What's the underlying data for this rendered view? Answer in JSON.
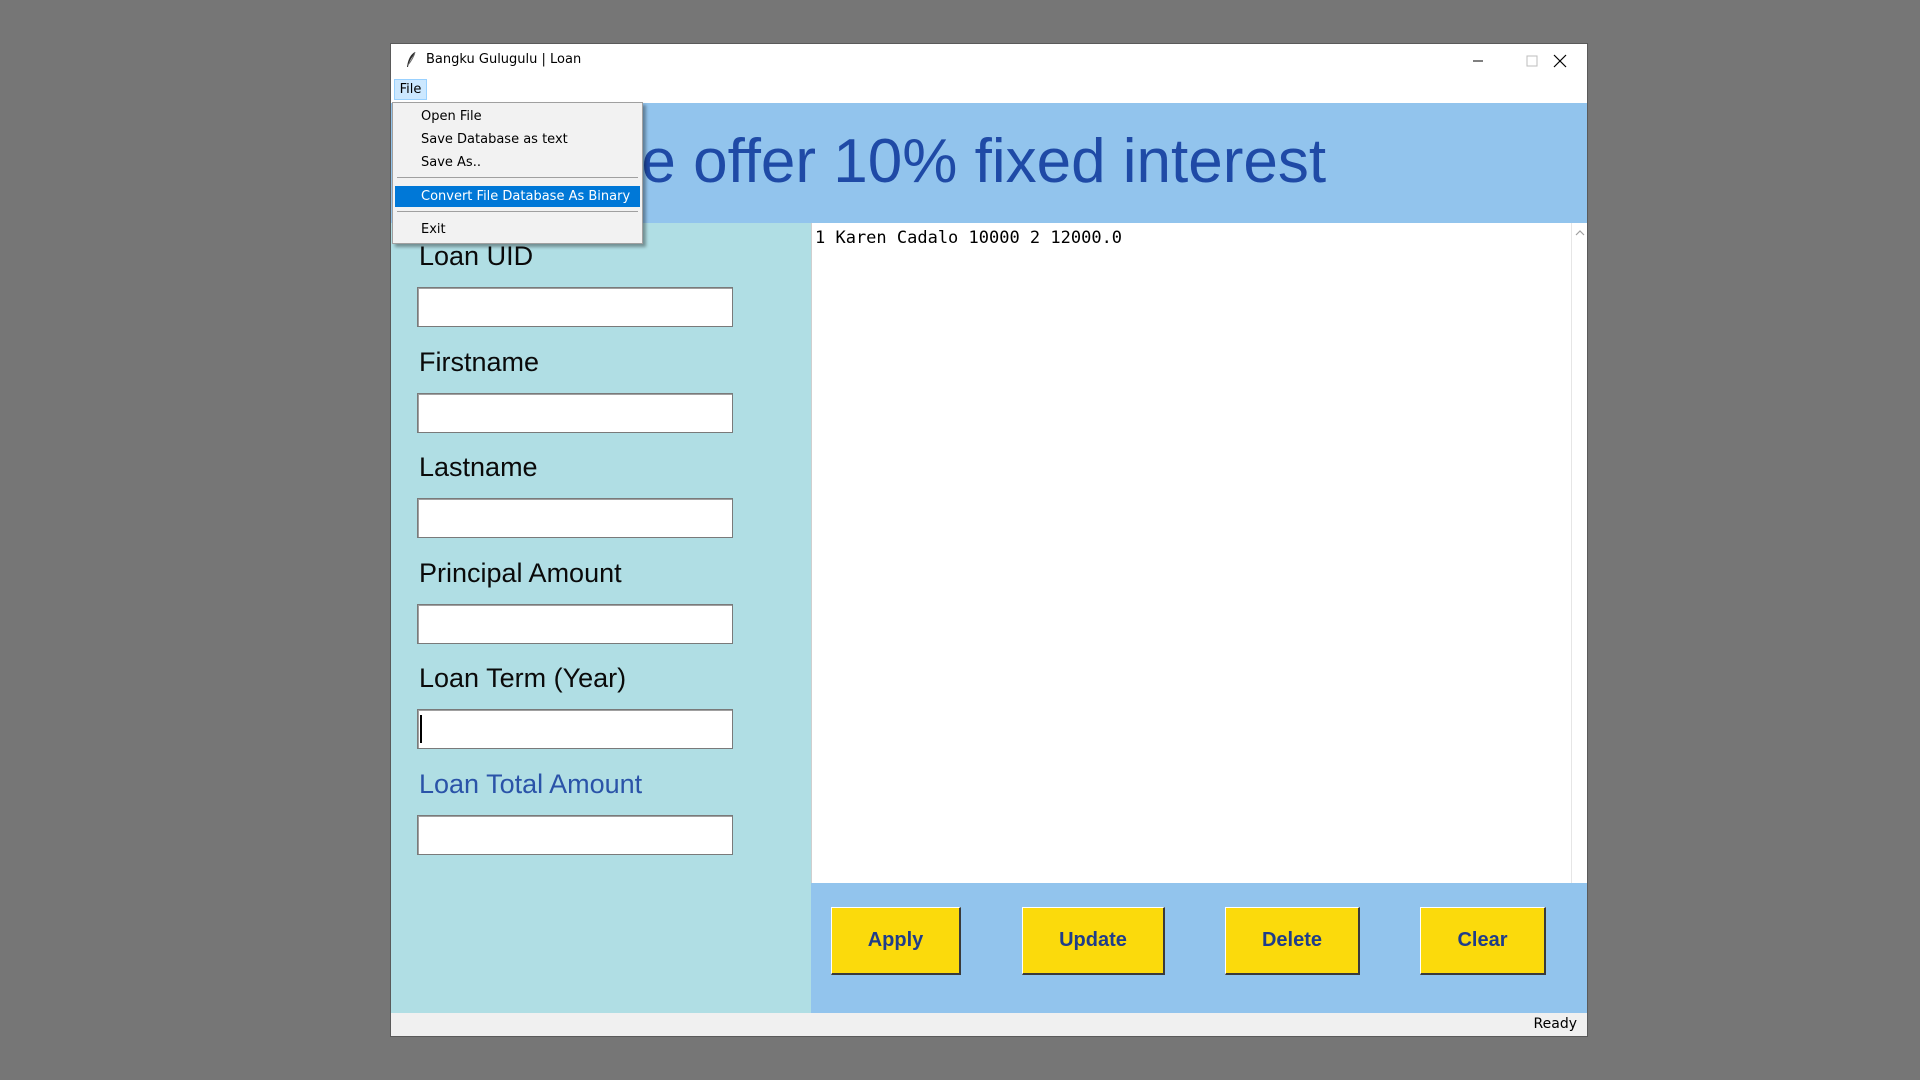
{
  "window": {
    "title": "Bangku Gulugulu | Loan",
    "app_icon": "feather-icon",
    "controls": [
      "minimize-icon",
      "maximize-icon",
      "close-icon"
    ]
  },
  "menubar": {
    "file_label": "File"
  },
  "file_menu": {
    "items": [
      "Open File",
      "Save Database as text",
      "Save As..",
      "Convert File Database As Binary",
      "Exit"
    ],
    "highlighted": "Convert File Database As Binary"
  },
  "banner": {
    "text": "We offer 10% fixed interest"
  },
  "form": {
    "fields": [
      {
        "label": "Loan UID",
        "value": ""
      },
      {
        "label": "Firstname",
        "value": ""
      },
      {
        "label": "Lastname",
        "value": ""
      },
      {
        "label": "Principal Amount",
        "value": ""
      },
      {
        "label": "Loan Term (Year)",
        "value": ""
      },
      {
        "label": "Loan Total Amount",
        "value": ""
      }
    ]
  },
  "records": {
    "lines": [
      "1 Karen Cadalo 10000 2 12000.0"
    ]
  },
  "buttons": {
    "apply": "Apply",
    "update": "Update",
    "delete": "Delete",
    "clear": "Clear"
  },
  "status": {
    "text": "Ready"
  },
  "colors": {
    "banner_bg": "#92c4ed",
    "banner_text": "#1f4aa6",
    "form_bg": "#b0dee4",
    "button_bg": "#fbda0c",
    "button_text": "#1f3d8a",
    "menu_highlight": "#0078d7"
  }
}
